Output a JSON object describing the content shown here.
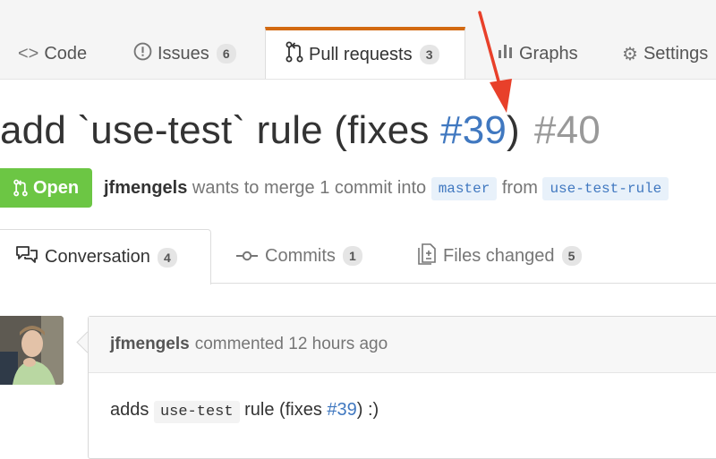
{
  "repo_nav": {
    "code": {
      "label": "Code",
      "icon": "code-icon"
    },
    "issues": {
      "label": "Issues",
      "count": "6",
      "icon": "issue-opened-icon"
    },
    "pulls": {
      "label": "Pull requests",
      "count": "3",
      "icon": "git-pull-request-icon"
    },
    "graphs": {
      "label": "Graphs",
      "icon": "graph-icon"
    },
    "settings": {
      "label": "Settings",
      "icon": "gear-icon"
    }
  },
  "pr": {
    "title_prefix": "add `use-test` rule (fixes ",
    "title_link": "#39",
    "title_suffix": ")",
    "number": "#40",
    "state": "Open",
    "author": "jfmengels",
    "merge_text": "wants to merge 1 commit into",
    "base_branch": "master",
    "from_text": "from",
    "head_branch": "use-test-rule"
  },
  "tabs": {
    "conversation": {
      "label": "Conversation",
      "count": "4",
      "icon": "comment-discussion-icon"
    },
    "commits": {
      "label": "Commits",
      "count": "1",
      "icon": "git-commit-icon"
    },
    "files": {
      "label": "Files changed",
      "count": "5",
      "icon": "diff-icon"
    }
  },
  "comment": {
    "author": "jfmengels",
    "meta": "commented 12 hours ago",
    "body_prefix": "adds",
    "body_code": "use-test",
    "body_middle": "rule (fixes",
    "body_link": "#39",
    "body_suffix": ") :)"
  },
  "colors": {
    "accent_orange": "#d26911",
    "link_blue": "#4078c0",
    "open_green": "#6cc644",
    "annotation_arrow": "#e8402a"
  }
}
